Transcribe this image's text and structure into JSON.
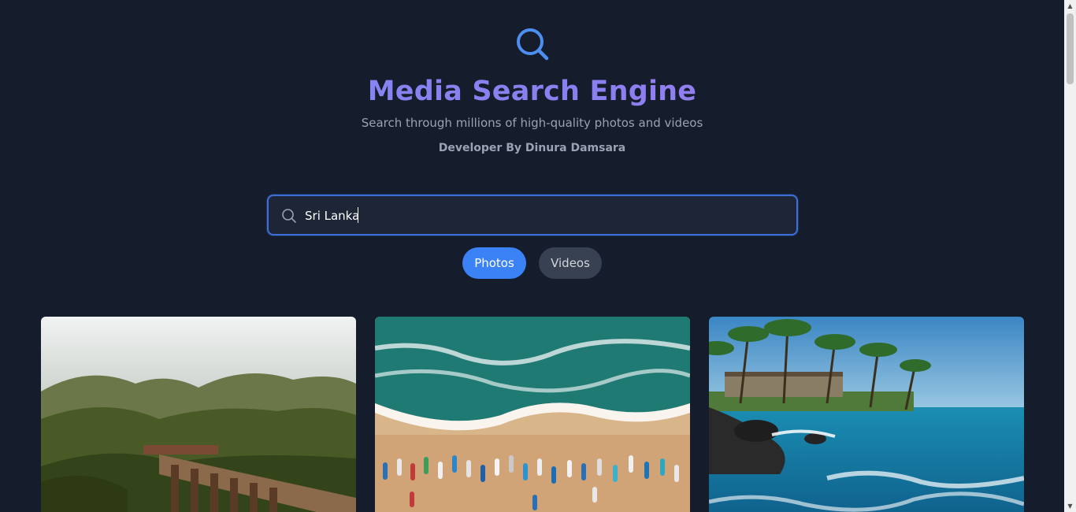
{
  "header": {
    "logo_icon": "search-icon",
    "title": "Media Search Engine",
    "subtitle": "Search through millions of high-quality photos and videos",
    "developer": "Developer By Dinura Damsara"
  },
  "search": {
    "icon": "search-icon",
    "value": "Sri Lanka",
    "accent_color": "#3d6fd8"
  },
  "tabs": [
    {
      "label": "Photos",
      "active": true,
      "color": "#3b82f6"
    },
    {
      "label": "Videos",
      "active": false,
      "color": "#374151"
    }
  ],
  "results": [
    {
      "description": "Train on stone arch bridge in misty forest"
    },
    {
      "description": "Aerial view of beach with colorful fishing boats and waves"
    },
    {
      "description": "Palm trees on rocky coast with turquoise sea"
    }
  ]
}
